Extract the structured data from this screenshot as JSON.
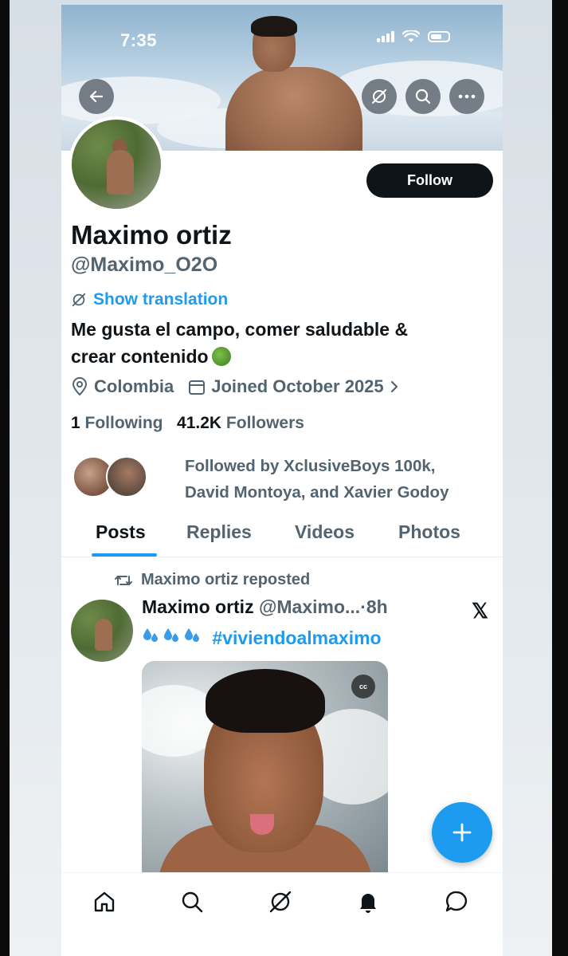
{
  "status_bar": {
    "time": "7:35"
  },
  "profile": {
    "name": "Maximo ortiz",
    "handle": "@Maximo_O2O",
    "follow_label": "Follow",
    "show_translation": "Show translation",
    "bio_line1": "Me gusta el campo, comer saludable &",
    "bio_line2": "crear contenido",
    "location": "Colombia",
    "joined": "Joined October 2025",
    "following_count": "1",
    "following_label": "Following",
    "followers_count": "41.2K",
    "followers_label": "Followers",
    "followed_by_line1": "Followed by XclusiveBoys 100k,",
    "followed_by_line2": "David Montoya, and Xavier Godoy"
  },
  "tabs": [
    {
      "label": "Posts",
      "active": true
    },
    {
      "label": "Replies",
      "active": false
    },
    {
      "label": "Videos",
      "active": false
    },
    {
      "label": "Photos",
      "active": false
    }
  ],
  "post": {
    "repost_label": "Maximo ortiz reposted",
    "author_name": "Maximo ortiz",
    "author_handle": "@Maximo...",
    "time": "·8h",
    "hashtag": "#viviendoalmaximo",
    "cc_label": "cc"
  },
  "icons": {
    "back": "arrow-left-icon",
    "grok": "grok-icon",
    "search": "search-icon",
    "more": "more-horizontal-icon",
    "location": "location-pin-icon",
    "calendar": "calendar-icon",
    "repost": "repost-icon",
    "x_logo": "x-logo-icon",
    "compose": "plus-icon",
    "nav": [
      "home-icon",
      "search-icon",
      "grok-icon",
      "bell-icon",
      "messages-icon"
    ]
  },
  "colors": {
    "accent": "#1d9bf0",
    "text_primary": "#0f1419",
    "text_secondary": "#536471",
    "follow_bg": "#0f1419"
  }
}
